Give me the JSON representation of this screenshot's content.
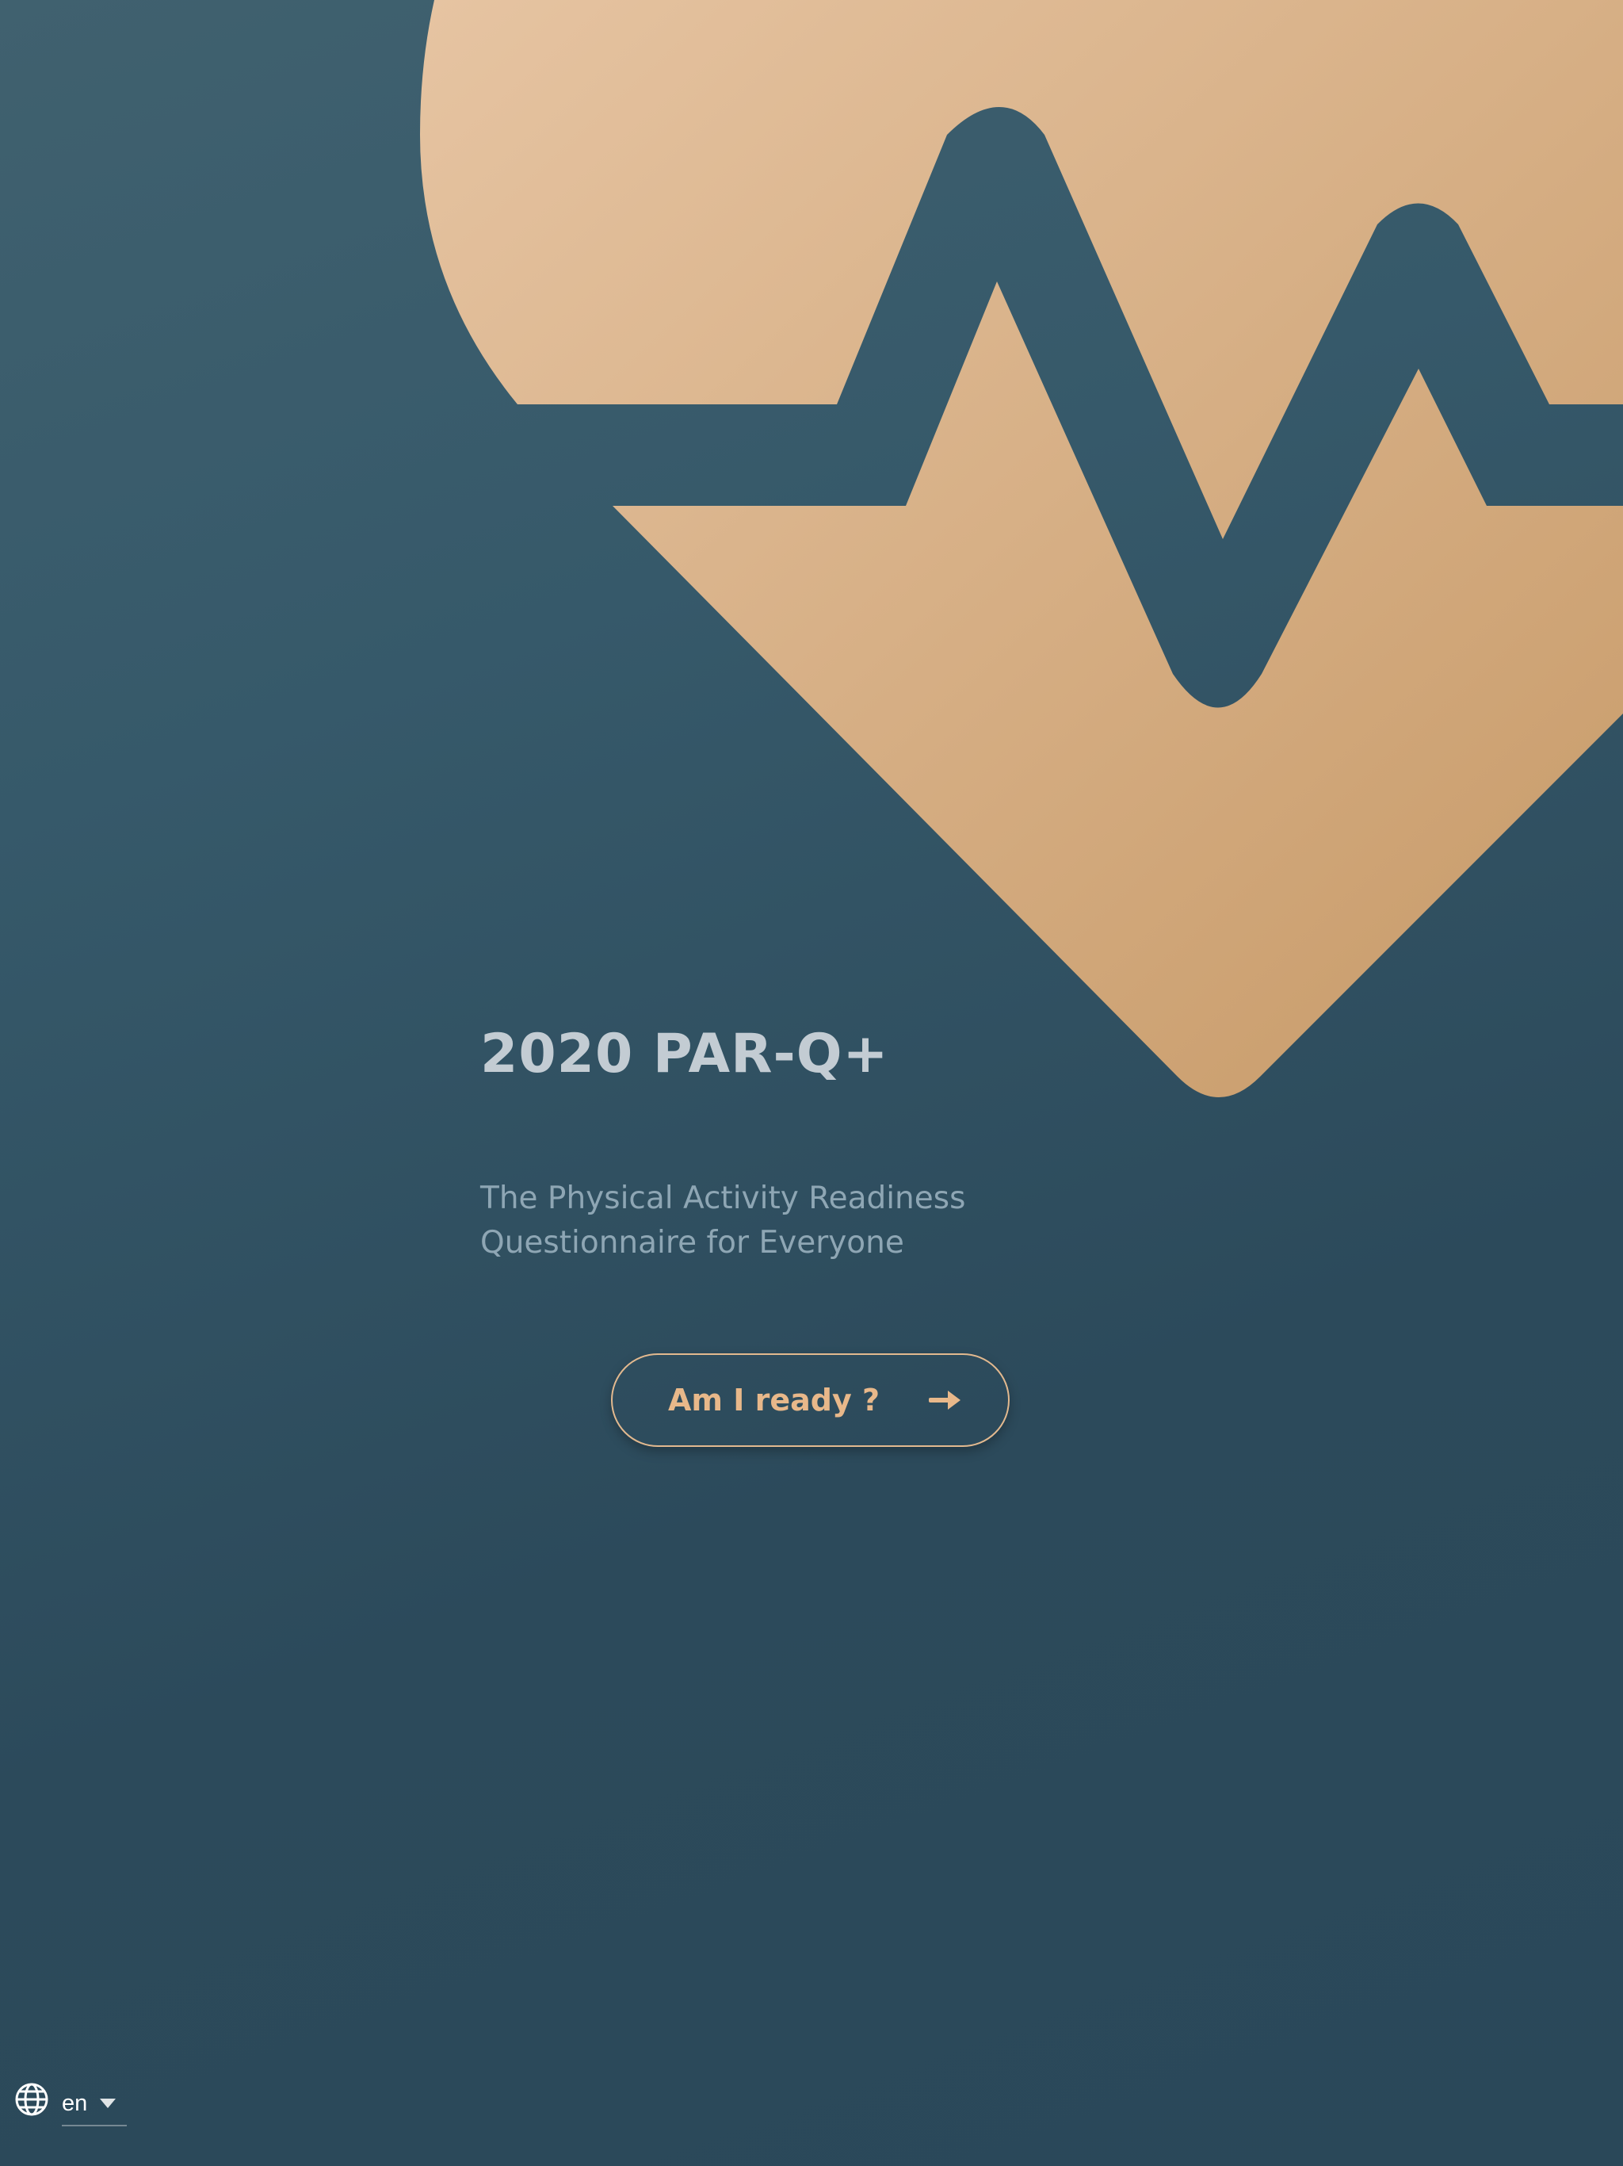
{
  "hero": {
    "title": "2020 PAR-Q+",
    "subtitle": "The Physical Activity Readiness Questionnaire for Everyone",
    "illustration_icon": "heart-pulse-icon"
  },
  "cta": {
    "label": "Am I ready ?",
    "icon": "arrow-right-icon"
  },
  "language": {
    "icon": "globe-icon",
    "selected": "en"
  },
  "colors": {
    "background": "#2c4a5b",
    "accent": "#e8b88a",
    "title": "#c3ccd3",
    "subtitle": "#8ea6b4"
  }
}
